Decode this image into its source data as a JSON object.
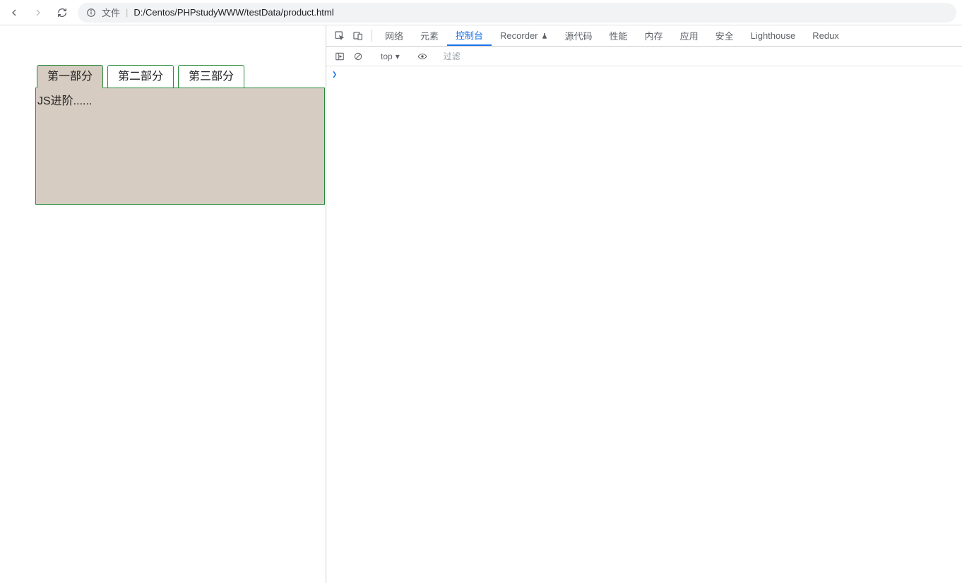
{
  "browser": {
    "address_label": "文件",
    "url": "D:/Centos/PHPstudyWWW/testData/product.html"
  },
  "page": {
    "tabs": [
      {
        "label": "第一部分",
        "active": true
      },
      {
        "label": "第二部分",
        "active": false
      },
      {
        "label": "第三部分",
        "active": false
      }
    ],
    "panel_content": "JS进阶......"
  },
  "devtools": {
    "tabs": {
      "network": "网络",
      "elements": "元素",
      "console": "控制台",
      "recorder": "Recorder",
      "sources": "源代码",
      "performance": "性能",
      "memory": "内存",
      "application": "应用",
      "security": "安全",
      "lighthouse": "Lighthouse",
      "redux": "Redux"
    },
    "active_tab": "console",
    "toolbar": {
      "context": "top",
      "filter_placeholder": "过滤"
    },
    "prompt": ""
  }
}
